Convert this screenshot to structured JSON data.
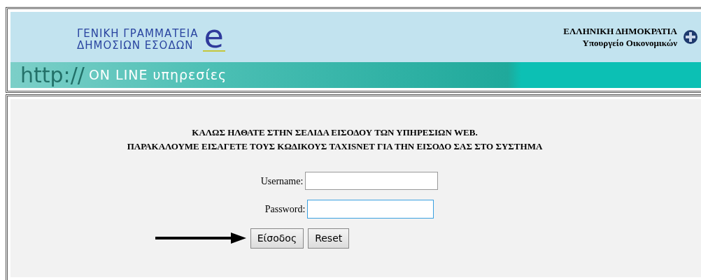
{
  "header": {
    "agency_lines": [
      "ΓΕΝΙΚΗ ΓΡΑΜΜΑΤΕΙΑ",
      "ΔΗΜΟΣΙΩΝ ΕΣΟΔΩΝ"
    ],
    "logo_letter": "e",
    "republic": "ΕΛΛΗΝΙΚΗ ΔΗΜΟΚΡΑΤΙΑ",
    "ministry": "Υπουργείο Οικονομικών"
  },
  "banner": {
    "prefix": "http://",
    "title": "ON LINE υπηρεσίες"
  },
  "welcome_lines": [
    "ΚΑΛΩΣ ΗΛΘΑΤΕ ΣΤΗΝ ΣΕΛΙΔΑ ΕΙΣΟΔΟΥ ΤΩΝ ΥΠΗΡΕΣΙΩΝ WEB.",
    "ΠΑΡΑΚΑΛΟΥΜΕ ΕΙΣΑΓΕΤΕ ΤΟΥΣ ΚΩΔΙΚΟΥΣ TAXISNET ΓΙΑ ΤΗΝ ΕΙΣΟΔΟ ΣΑΣ ΣΤΟ ΣΥΣΤΗΜΑ"
  ],
  "fields": [
    {
      "label": "Username:",
      "focused": false
    },
    {
      "label": "Password:",
      "focused": true
    }
  ],
  "buttons": [
    "Είσοδος",
    "Reset"
  ]
}
